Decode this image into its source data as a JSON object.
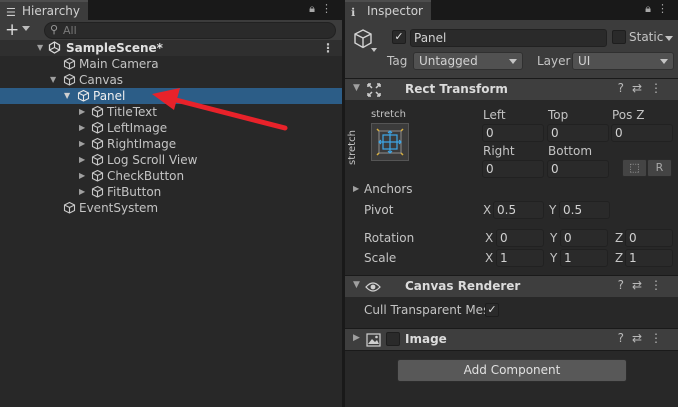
{
  "hierarchy": {
    "tab_title": "Hierarchy",
    "search_placeholder": "All",
    "scene_name": "SampleScene*",
    "items": [
      {
        "label": "Main Camera"
      },
      {
        "label": "Canvas"
      },
      {
        "label": "Panel"
      },
      {
        "label": "TitleText"
      },
      {
        "label": "LeftImage"
      },
      {
        "label": "RightImage"
      },
      {
        "label": "Log Scroll View"
      },
      {
        "label": "CheckButton"
      },
      {
        "label": "FitButton"
      },
      {
        "label": "EventSystem"
      }
    ]
  },
  "inspector": {
    "tab_title": "Inspector",
    "object_name": "Panel",
    "static_label": "Static",
    "tag_label": "Tag",
    "tag_value": "Untagged",
    "layer_label": "Layer",
    "layer_value": "UI",
    "rect_transform": {
      "title": "Rect Transform",
      "stretch_h": "stretch",
      "stretch_v": "stretch",
      "left_label": "Left",
      "left_value": "0",
      "top_label": "Top",
      "top_value": "0",
      "posz_label": "Pos Z",
      "posz_value": "0",
      "right_label": "Right",
      "right_value": "0",
      "bottom_label": "Bottom",
      "bottom_value": "0",
      "r_button": "R",
      "anchors_label": "Anchors",
      "pivot_label": "Pivot",
      "pivot_x_label": "X",
      "pivot_x": "0.5",
      "pivot_y_label": "Y",
      "pivot_y": "0.5",
      "rotation_label": "Rotation",
      "rot_x": "0",
      "rot_y": "0",
      "rot_z": "0",
      "scale_label": "Scale",
      "scale_x": "1",
      "scale_y": "1",
      "scale_z": "1",
      "x_label": "X",
      "y_label": "Y",
      "z_label": "Z"
    },
    "canvas_renderer": {
      "title": "Canvas Renderer",
      "cull_label": "Cull Transparent Mes",
      "cull_checked": "✓"
    },
    "image": {
      "title": "Image"
    },
    "add_component": "Add Component"
  },
  "colors": {
    "selection": "#2c5d87",
    "arrow": "#e8222a",
    "panel_bg": "#282828",
    "header_bg": "#3e3e3e"
  }
}
